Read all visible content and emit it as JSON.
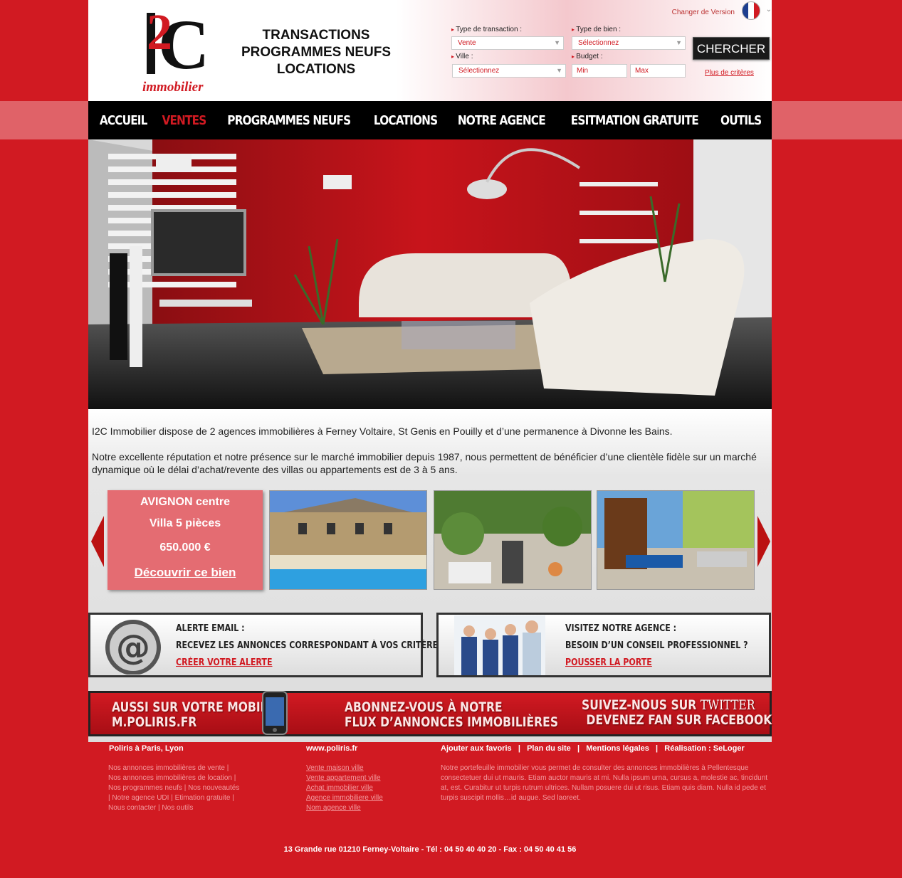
{
  "header": {
    "logo_number": "2",
    "logo_letter": "C",
    "logo_sub": "immobilier",
    "taglines": [
      "TRANSACTIONS",
      "PROGRAMMES NEUFS",
      "LOCATIONS"
    ],
    "version_label": "Changer de Version"
  },
  "search": {
    "transaction_label": "Type de transaction :",
    "transaction_value": "Vente",
    "property_label": "Type de bien :",
    "property_value": "Sélectionnez",
    "city_label": "Ville :",
    "city_value": "Sélectionnez",
    "budget_label": "Budget :",
    "budget_min": "Min",
    "budget_max": "Max",
    "button": "CHERCHER",
    "more_link": "Plus de critères"
  },
  "nav": [
    "ACCUEIL",
    "VENTES",
    "PROGRAMMES NEUFS",
    "LOCATIONS",
    "NOTRE AGENCE",
    "ESITMATION GRATUITE",
    "OUTILS"
  ],
  "intro": {
    "p1": "I2C Immobilier dispose de 2 agences immobilières à Ferney Voltaire, St Genis en Pouilly et d’une permanence à Divonne les Bains.",
    "p2": "Notre excellente réputation et notre présence sur le marché immobilier depuis 1987, nous permettent de bénéficier d’une clientèle fidèle sur un marché dynamique où le délai d’achat/revente des villas ou appartements est de 3 à 5 ans."
  },
  "feature": {
    "city": "AVIGNON centre",
    "type": "Villa 5 pièces",
    "price": "650.000 €",
    "link": "Découvrir ce bien"
  },
  "alert_box": {
    "title": "ALERTE EMAIL :",
    "text": "RECEVEZ LES ANNONCES CORRESPONDANT À VOS CRITÈRES",
    "link": "CRÉER VOTRE ALERTE"
  },
  "agency_box": {
    "title": "VISITEZ NOTRE AGENCE :",
    "text": "BESOIN D’UN CONSEIL PROFESSIONNEL ?",
    "link": "POUSSER LA PORTE"
  },
  "banner": {
    "mobile_line1": "AUSSI SUR VOTRE  MOBILE",
    "mobile_line2": "M.POLIRIS.FR",
    "feed_line1": "ABONNEZ-VOUS À NOTRE",
    "feed_line2": "FLUX D’ANNONCES IMMOBILIÈRES",
    "twitter_prefix": "SUIVEZ-NOUS SUR ",
    "twitter_word": "TWITTER",
    "facebook": "DEVENEZ FAN SUR FACEBOOK"
  },
  "footer": {
    "col1_title": "Poliris à Paris, Lyon",
    "col1_lines": [
      "Nos annonces immobilières de vente |",
      "Nos annonces immobilières de location |",
      "Nos programmes neufs | Nos nouveautés",
      "| Notre agence UDI | Etimation gratuite |",
      "Nous contacter | Nos outils"
    ],
    "col2_title": "www.poliris.fr",
    "col2_links": [
      "Vente maison ville",
      "Vente appartement ville",
      "Achat immobilier ville",
      "Agence immobiliere ville",
      "Nom agence ville"
    ],
    "links": {
      "favoris": "Ajouter aux favoris",
      "plan": "Plan du site",
      "mentions": "Mentions légales",
      "realisation": "Réalisation : SeLoger"
    },
    "separator": "|",
    "col3_text": "Notre portefeuille immobilier vous permet de consulter des annonces immobilières à Pellentesque consectetuer dui ut mauris. Etiam auctor mauris at mi. Nulla ipsum urna, cursus a, molestie ac, tincidunt at, est. Curabitur ut turpis rutrum ultrices. Nullam posuere dui ut risus. Etiam quis diam. Nulla id pede et turpis suscipit mollis…id augue. Sed laoreet.",
    "address": "13 Grande rue 01210 Ferney-Voltaire -  Tél : 04 50 40 40 20 - Fax : 04 50 40 41 56"
  },
  "colors": {
    "brand_red": "#d11a22",
    "nav_bg": "#000000"
  }
}
